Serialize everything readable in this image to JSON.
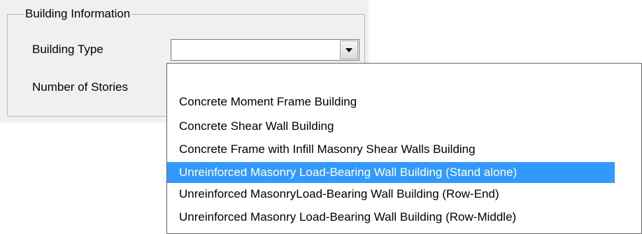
{
  "group": {
    "title": "Building Information"
  },
  "fields": {
    "building_type_label": "Building Type",
    "stories_label": "Number of Stories"
  },
  "combo": {
    "value": "",
    "icon": "chevron-down-icon"
  },
  "dropdown": {
    "items": [
      "",
      "Concrete Moment Frame Building",
      "Concrete Shear Wall Building",
      "Concrete Frame with Infill Masonry Shear Walls Building",
      "Unreinforced Masonry Load-Bearing Wall Building (Stand alone)",
      "Unreinforced MasonryLoad-Bearing Wall Building (Row-End)",
      "Unreinforced Masonry Load-Bearing Wall Building (Row-Middle)"
    ],
    "selected_index": 4
  },
  "colors": {
    "selection": "#3399ff",
    "window": "#f0f0f0"
  }
}
